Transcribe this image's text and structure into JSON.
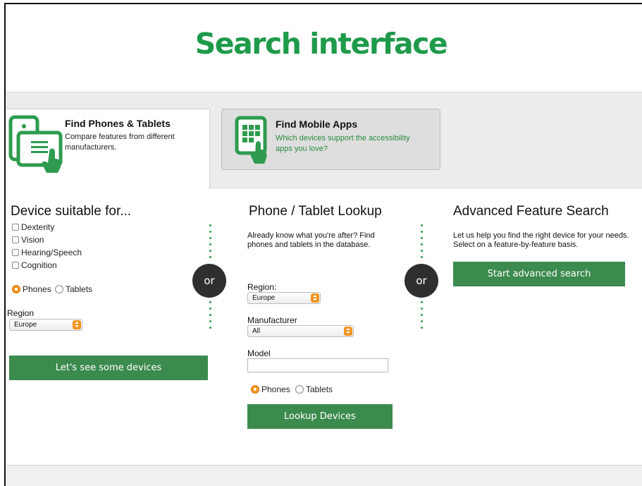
{
  "page": {
    "title": "Search interface"
  },
  "tabs": [
    {
      "title": "Find Phones & Tablets",
      "description": "Compare features from different manufacturers.",
      "icon": "phone-tablet-icon",
      "active": true
    },
    {
      "title": "Find Mobile Apps",
      "description": "Which devices support the accessibility apps you love?",
      "icon": "apps-grid-icon",
      "active": false
    }
  ],
  "device_search": {
    "heading": "Device suitable for...",
    "options": [
      "Dexterity",
      "Vision",
      "Hearing/Speech",
      "Cognition"
    ],
    "radios": {
      "phones": "Phones",
      "tablets": "Tablets",
      "selected": "Phones"
    },
    "region_label": "Region",
    "region_value": "Europe",
    "button": "Let's see some devices"
  },
  "or_label": "or",
  "lookup": {
    "heading": "Phone / Tablet Lookup",
    "description": "Already know what you're after? Find phones and tablets in the database.",
    "region_label": "Region:",
    "region_value": "Europe",
    "manufacturer_label": "Manufacturer",
    "manufacturer_value": "All",
    "model_label": "Model",
    "model_value": "",
    "radios": {
      "phones": "Phones",
      "tablets": "Tablets",
      "selected": "Phones"
    },
    "button": "Lookup Devices"
  },
  "advanced": {
    "heading": "Advanced Feature Search",
    "description": "Let us help you find the right device for your needs. Select on a feature-by-feature basis.",
    "button": "Start advanced search"
  },
  "colors": {
    "brand_green": "#1e9a4b",
    "button_green": "#3c8b4e",
    "accent_orange": "#f5941f"
  }
}
